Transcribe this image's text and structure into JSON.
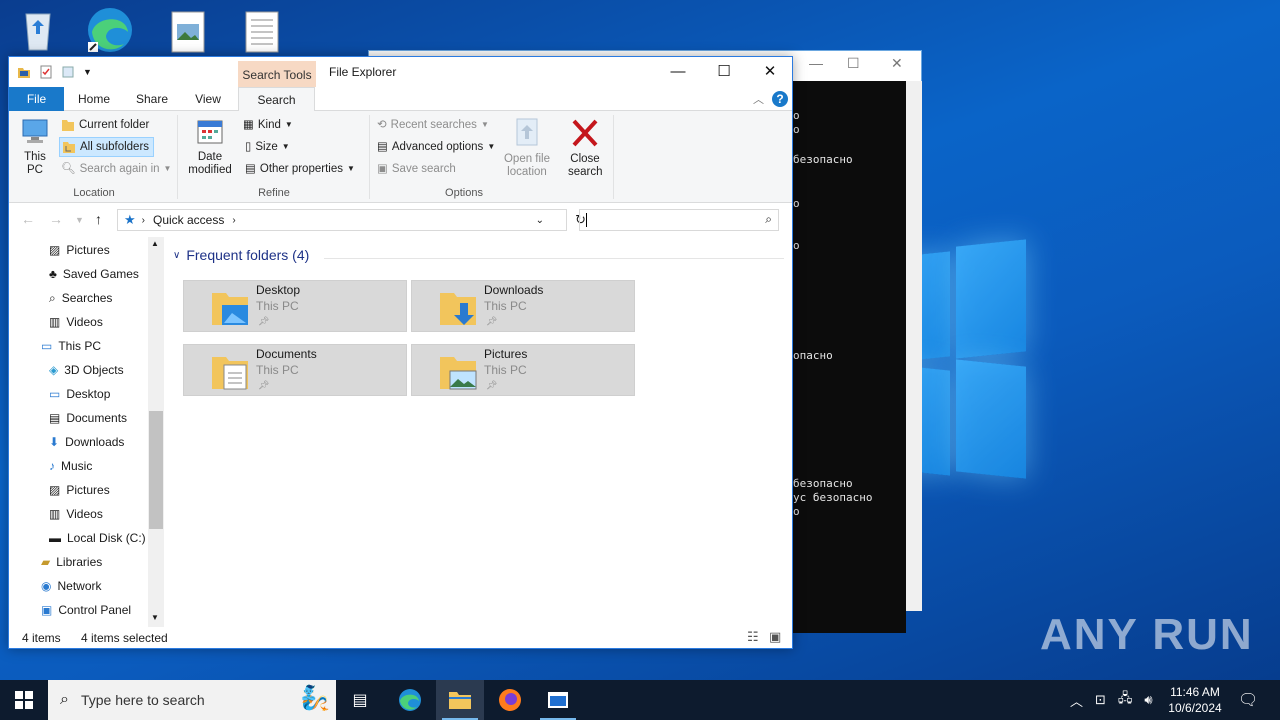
{
  "console": {
    "lines": [
      "о",
      "о",
      "безопасно",
      "о",
      "о",
      "опасно",
      "безопасно",
      "ус безопасно",
      "о"
    ]
  },
  "explorer": {
    "context_tab": "Search Tools",
    "title": "File Explorer",
    "tabs": [
      "File",
      "Home",
      "Share",
      "View",
      "Search"
    ],
    "ribbon": {
      "location": {
        "this_pc": "This PC",
        "current_folder": "Current folder",
        "all_subfolders": "All subfolders",
        "search_again_in": "Search again in",
        "label": "Location"
      },
      "refine": {
        "date_modified": "Date modified",
        "kind": "Kind",
        "size": "Size",
        "other_properties": "Other properties",
        "label": "Refine"
      },
      "options": {
        "recent_searches": "Recent searches",
        "advanced_options": "Advanced options",
        "save_search": "Save search",
        "open_file_location": "Open file location",
        "close_search": "Close search",
        "label": "Options"
      }
    },
    "address": {
      "crumb": "Quick access"
    },
    "nav_items": [
      {
        "label": "Pictures",
        "icon": "pictures-icon"
      },
      {
        "label": "Saved Games",
        "icon": "saved-games-icon"
      },
      {
        "label": "Searches",
        "icon": "searches-icon"
      },
      {
        "label": "Videos",
        "icon": "videos-icon"
      },
      {
        "label": "This PC",
        "icon": "this-pc-icon"
      },
      {
        "label": "3D Objects",
        "icon": "3d-objects-icon"
      },
      {
        "label": "Desktop",
        "icon": "desktop-icon"
      },
      {
        "label": "Documents",
        "icon": "documents-icon"
      },
      {
        "label": "Downloads",
        "icon": "downloads-icon"
      },
      {
        "label": "Music",
        "icon": "music-icon"
      },
      {
        "label": "Pictures",
        "icon": "pictures-icon"
      },
      {
        "label": "Videos",
        "icon": "videos-icon"
      },
      {
        "label": "Local Disk (C:)",
        "icon": "disk-icon"
      },
      {
        "label": "Libraries",
        "icon": "libraries-icon"
      },
      {
        "label": "Network",
        "icon": "network-icon"
      },
      {
        "label": "Control Panel",
        "icon": "control-panel-icon"
      }
    ],
    "group_header": "Frequent folders (4)",
    "tiles": [
      {
        "name": "Desktop",
        "sub": "This PC"
      },
      {
        "name": "Downloads",
        "sub": "This PC"
      },
      {
        "name": "Documents",
        "sub": "This PC"
      },
      {
        "name": "Pictures",
        "sub": "This PC"
      }
    ],
    "status": {
      "items": "4 items",
      "selected": "4 items selected"
    }
  },
  "taskbar": {
    "search_placeholder": "Type here to search",
    "time": "11:46 AM",
    "date": "10/6/2024"
  },
  "watermark": "ANY RUN"
}
